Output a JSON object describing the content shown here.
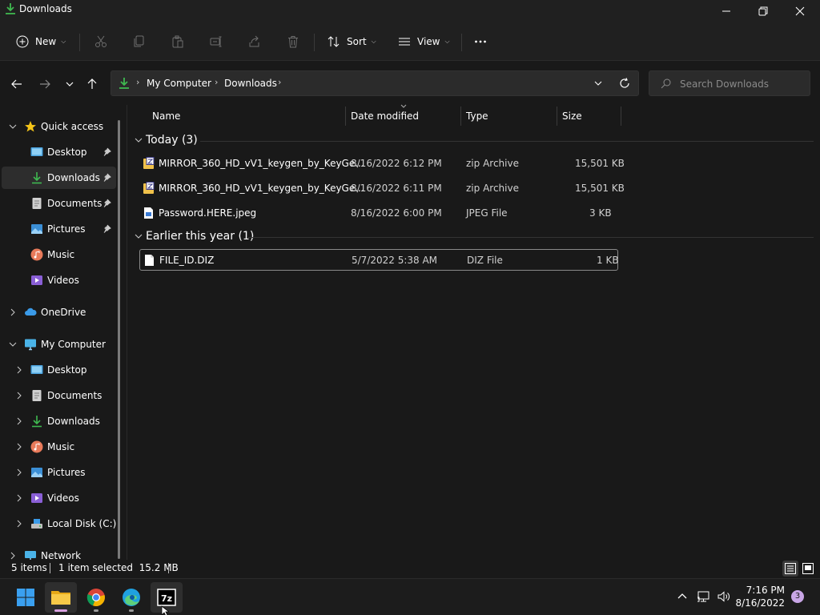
{
  "window": {
    "title": "Downloads"
  },
  "commandbar": {
    "new_label": "New",
    "sort_label": "Sort",
    "view_label": "View"
  },
  "address": {
    "crumbs": [
      "My Computer",
      "Downloads"
    ]
  },
  "search": {
    "placeholder": "Search Downloads"
  },
  "sidebar": {
    "items": [
      {
        "label": "Quick access",
        "icon": "star-icon"
      },
      {
        "label": "Desktop",
        "icon": "desktop-icon",
        "pinned": true
      },
      {
        "label": "Downloads",
        "icon": "download-icon",
        "pinned": true,
        "selected": true
      },
      {
        "label": "Documents",
        "icon": "documents-icon",
        "pinned": true
      },
      {
        "label": "Pictures",
        "icon": "pictures-icon",
        "pinned": true
      },
      {
        "label": "Music",
        "icon": "music-icon"
      },
      {
        "label": "Videos",
        "icon": "videos-icon"
      },
      {
        "label": "OneDrive",
        "icon": "cloud-icon"
      },
      {
        "label": "My Computer",
        "icon": "computer-icon"
      },
      {
        "label": "Desktop",
        "icon": "desktop-icon"
      },
      {
        "label": "Documents",
        "icon": "documents-icon"
      },
      {
        "label": "Downloads",
        "icon": "download-icon"
      },
      {
        "label": "Music",
        "icon": "music-icon"
      },
      {
        "label": "Pictures",
        "icon": "pictures-icon"
      },
      {
        "label": "Videos",
        "icon": "videos-icon"
      },
      {
        "label": "Local Disk (C:)",
        "icon": "disk-icon"
      },
      {
        "label": "Network",
        "icon": "network-icon"
      }
    ]
  },
  "columns": {
    "name": "Name",
    "date": "Date modified",
    "type": "Type",
    "size": "Size"
  },
  "groups": [
    {
      "label": "Today (3)"
    },
    {
      "label": "Earlier this year (1)"
    }
  ],
  "files": [
    {
      "name": "MIRROR_360_HD_vV1_keygen_by_KeyGe...",
      "date": "8/16/2022 6:12 PM",
      "type": "zip Archive",
      "size": "15,501 KB",
      "icon": "zip-icon"
    },
    {
      "name": "MIRROR_360_HD_vV1_keygen_by_KeyGe...",
      "date": "8/16/2022 6:11 PM",
      "type": "zip Archive",
      "size": "15,501 KB",
      "icon": "zip-icon"
    },
    {
      "name": "Password.HERE.jpeg",
      "date": "8/16/2022 6:00 PM",
      "type": "JPEG File",
      "size": "3 KB",
      "icon": "image-file-icon"
    },
    {
      "name": "FILE_ID.DIZ",
      "date": "5/7/2022 5:38 AM",
      "type": "DIZ File",
      "size": "1 KB",
      "icon": "file-icon",
      "selected": true
    }
  ],
  "status": {
    "count": "5 items",
    "selection": "1 item selected  15.2 MB"
  },
  "taskbar": {
    "time": "7:16 PM",
    "date": "8/16/2022",
    "notifications": "3"
  },
  "colors": {
    "accent_green": "#3fb950",
    "folder_yellow": "#f0c14b",
    "selection_bg": "#2d2d2d"
  }
}
